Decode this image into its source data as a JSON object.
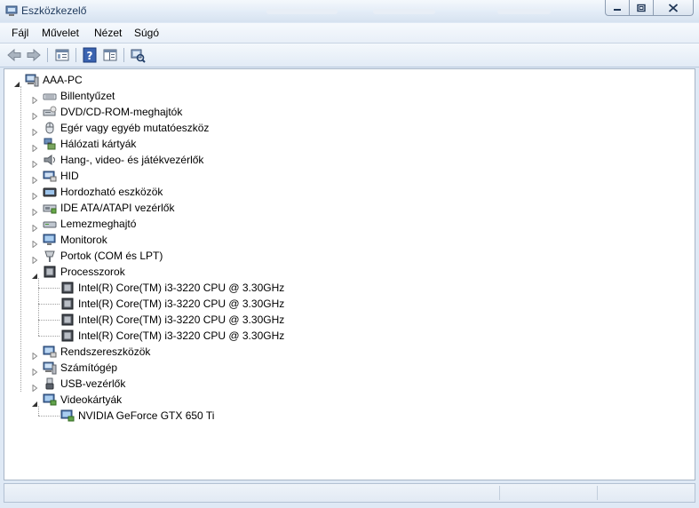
{
  "window": {
    "title": "Eszközkezelő",
    "colors": {
      "title_text": "#1e395b",
      "frame": "#dfe9f5",
      "content_bg": "#ffffff"
    }
  },
  "menu": {
    "items": [
      {
        "label": "Fájl"
      },
      {
        "label": "Művelet"
      },
      {
        "label": "Nézet"
      },
      {
        "label": "Súgó"
      }
    ]
  },
  "toolbar": {
    "buttons": [
      {
        "icon": "back-arrow-icon"
      },
      {
        "icon": "forward-arrow-icon"
      },
      {
        "icon": "properties-view-icon"
      },
      {
        "icon": "help-icon"
      },
      {
        "icon": "details-pane-icon"
      },
      {
        "icon": "scan-hardware-icon"
      }
    ]
  },
  "tree": {
    "root": {
      "label": "AAA-PC",
      "icon": "computer-icon",
      "expanded": true
    },
    "categories": [
      {
        "label": "Billentyűzet",
        "icon": "keyboard-icon",
        "expanded": false
      },
      {
        "label": "DVD/CD-ROM-meghajtók",
        "icon": "dvd-drive-icon",
        "expanded": false
      },
      {
        "label": "Egér vagy egyéb mutatóeszköz",
        "icon": "mouse-icon",
        "expanded": false
      },
      {
        "label": "Hálózati kártyák",
        "icon": "network-adapter-icon",
        "expanded": false
      },
      {
        "label": "Hang-, video- és játékvezérlők",
        "icon": "speaker-icon",
        "expanded": false
      },
      {
        "label": "HID",
        "icon": "hid-icon",
        "expanded": false
      },
      {
        "label": "Hordozható eszközök",
        "icon": "portable-device-icon",
        "expanded": false
      },
      {
        "label": "IDE ATA/ATAPI vezérlők",
        "icon": "ide-controller-icon",
        "expanded": false
      },
      {
        "label": "Lemezmeghajtó",
        "icon": "disk-drive-icon",
        "expanded": false
      },
      {
        "label": "Monitorok",
        "icon": "monitor-icon",
        "expanded": false
      },
      {
        "label": "Portok (COM és LPT)",
        "icon": "port-icon",
        "expanded": false
      },
      {
        "label": "Processzorok",
        "icon": "processor-icon",
        "expanded": true,
        "children": [
          {
            "label": "Intel(R) Core(TM) i3-3220 CPU @ 3.30GHz",
            "icon": "processor-icon"
          },
          {
            "label": "Intel(R) Core(TM) i3-3220 CPU @ 3.30GHz",
            "icon": "processor-icon"
          },
          {
            "label": "Intel(R) Core(TM) i3-3220 CPU @ 3.30GHz",
            "icon": "processor-icon"
          },
          {
            "label": "Intel(R) Core(TM) i3-3220 CPU @ 3.30GHz",
            "icon": "processor-icon"
          }
        ]
      },
      {
        "label": "Rendszereszközök",
        "icon": "system-device-icon",
        "expanded": false
      },
      {
        "label": "Számítógép",
        "icon": "computer-icon",
        "expanded": false
      },
      {
        "label": "USB-vezérlők",
        "icon": "usb-icon",
        "expanded": false
      },
      {
        "label": "Videokártyák",
        "icon": "display-adapter-icon",
        "expanded": true,
        "children": [
          {
            "label": "NVIDIA GeForce GTX 650 Ti",
            "icon": "display-adapter-icon"
          }
        ]
      }
    ]
  }
}
